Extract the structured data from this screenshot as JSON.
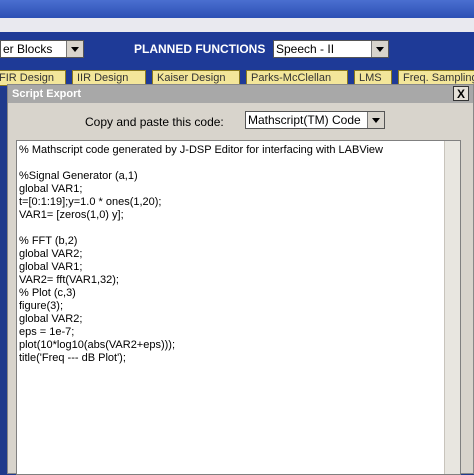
{
  "top": {
    "blocks_select_value": "er Blocks",
    "planned_functions_label": "PLANNED FUNCTIONS",
    "functions_select_value": "Speech - II"
  },
  "tabs": [
    "FIR Design",
    "IIR Design",
    "Kaiser Design",
    "Parks-McClellan",
    "LMS",
    "Freq. Sampling"
  ],
  "dialog": {
    "title": "Script Export",
    "close_label": "X",
    "copy_label": "Copy and paste this code:",
    "format_select_value": "Mathscript(TM) Code",
    "code": "% Mathscript code generated by J-DSP Editor for interfacing with LABView\n\n%Signal Generator (a,1)\nglobal VAR1;\nt=[0:1:19];y=1.0 * ones(1,20);\nVAR1= [zeros(1,0) y];\n\n% FFT (b,2)\nglobal VAR2;\nglobal VAR1;\nVAR2= fft(VAR1,32);\n% Plot (c,3)\nfigure(3);\nglobal VAR2;\neps = 1e-7;\nplot(10*log10(abs(VAR2+eps)));\ntitle('Freq --- dB Plot');"
  }
}
